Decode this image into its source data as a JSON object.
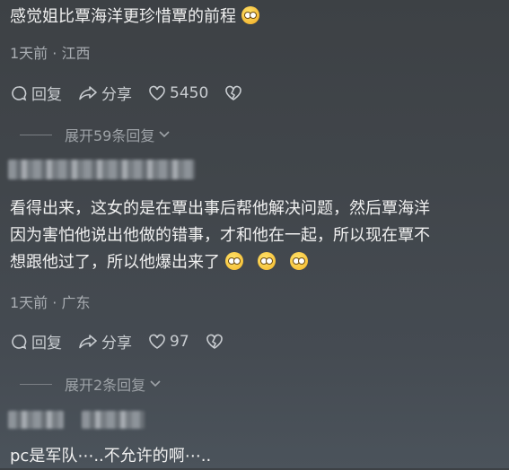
{
  "comment1": {
    "text": "感觉姐比覃海洋更珍惜覃的前程",
    "emoji": "rolling-laughing",
    "meta": "1天前 · 江西",
    "reply_label": "回复",
    "share_label": "分享",
    "like_count": "5450",
    "expand_label": "展开59条回复"
  },
  "comment2": {
    "line1": "看得出来，这女的是在覃出事后帮他解决问题，然后覃海洋",
    "line2": "因为害怕他说出他做的错事，才和他在一起，所以现在覃不",
    "line3": "想跟他过了，所以他爆出来了",
    "meta": "1天前 · 广东",
    "reply_label": "回复",
    "share_label": "分享",
    "like_count": "97",
    "expand_label": "展开2条回复"
  },
  "comment3": {
    "text": "pc是军队⋯..不允许的啊⋯.."
  }
}
